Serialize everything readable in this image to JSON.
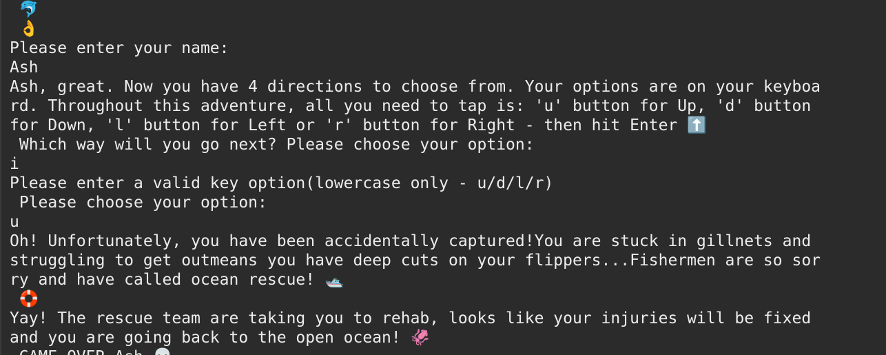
{
  "terminal": {
    "lines": [
      {
        "text": " 🐬"
      },
      {
        "text": " 👌"
      },
      {
        "text": "Please enter your name:"
      },
      {
        "text": "Ash"
      },
      {
        "text": "Ash, great. Now you have 4 directions to choose from. Your options are on your keyboa"
      },
      {
        "text": "rd. Throughout this adventure, all you need to tap is: 'u' button for Up, 'd' button"
      },
      {
        "text": "for Down, 'l' button for Left or 'r' button for Right - then hit Enter ⬆️"
      },
      {
        "text": " Which way will you go next? Please choose your option:"
      },
      {
        "text": "i"
      },
      {
        "text": "Please enter a valid key option(lowercase only - u/d/l/r)"
      },
      {
        "text": " Please choose your option:"
      },
      {
        "text": "u"
      },
      {
        "text": "Oh! Unfortunately, you have been accidentally captured!You are stuck in gillnets and"
      },
      {
        "text": "struggling to get outmeans you have deep cuts on your flippers...Fishermen are so sor"
      },
      {
        "text": "ry and have called ocean rescue! 🛥️"
      },
      {
        "text": " 🛟"
      },
      {
        "text": "Yay! The rescue team are taking you to rehab, looks like your injuries will be fixed"
      },
      {
        "text": "and you are going back to the open ocean! 🦑"
      },
      {
        "text": " GAME OVER Ash 💀"
      }
    ]
  }
}
